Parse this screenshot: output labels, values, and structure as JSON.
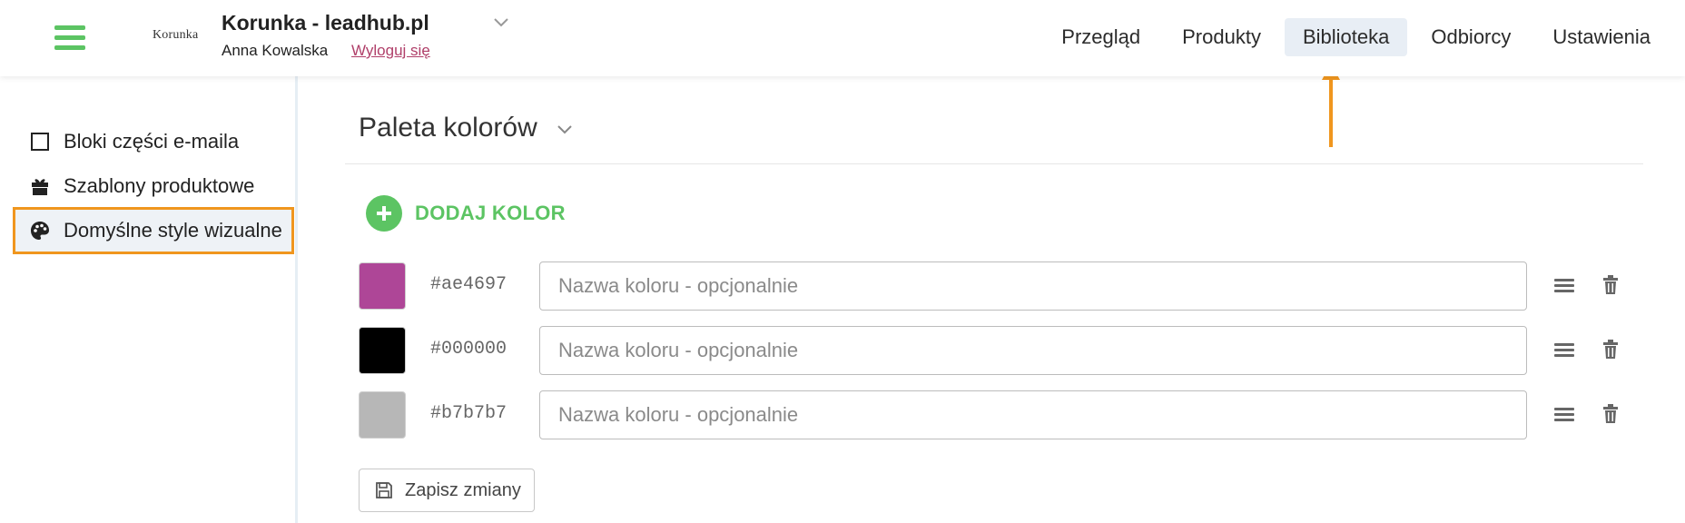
{
  "header": {
    "logo_text": "Korunka",
    "account_name": "Korunka - leadhub.pl",
    "user_name": "Anna Kowalska",
    "logout_label": "Wyloguj się",
    "nav": [
      {
        "label": "Przegląd",
        "active": false
      },
      {
        "label": "Produkty",
        "active": false
      },
      {
        "label": "Biblioteka",
        "active": true
      },
      {
        "label": "Odbiorcy",
        "active": false
      },
      {
        "label": "Ustawienia",
        "active": false
      }
    ]
  },
  "sidebar": {
    "items": [
      {
        "label": "Bloki części e-maila",
        "icon": "square-outline-icon"
      },
      {
        "label": "Szablony produktowe",
        "icon": "gift-icon"
      },
      {
        "label": "Domyślne style wizualne",
        "icon": "palette-icon",
        "highlighted": true
      }
    ]
  },
  "main": {
    "title": "Paleta kolorów",
    "add_color_label": "DODAJ KOLOR",
    "colors": [
      {
        "swatch": "#ae4697",
        "hex": "#ae4697",
        "name_value": "",
        "name_placeholder": "Nazwa koloru - opcjonalnie"
      },
      {
        "swatch": "#000000",
        "hex": "#000000",
        "name_value": "",
        "name_placeholder": "Nazwa koloru - opcjonalnie"
      },
      {
        "swatch": "#b7b7b7",
        "hex": "#b7b7b7",
        "name_value": "",
        "name_placeholder": "Nazwa koloru - opcjonalnie"
      }
    ],
    "save_label": "Zapisz zmiany"
  },
  "theme": {
    "accent_green": "#5cc463",
    "highlight_orange": "#f0961e",
    "logout_color": "#b0406a",
    "active_nav_bg": "#e8eef5"
  }
}
